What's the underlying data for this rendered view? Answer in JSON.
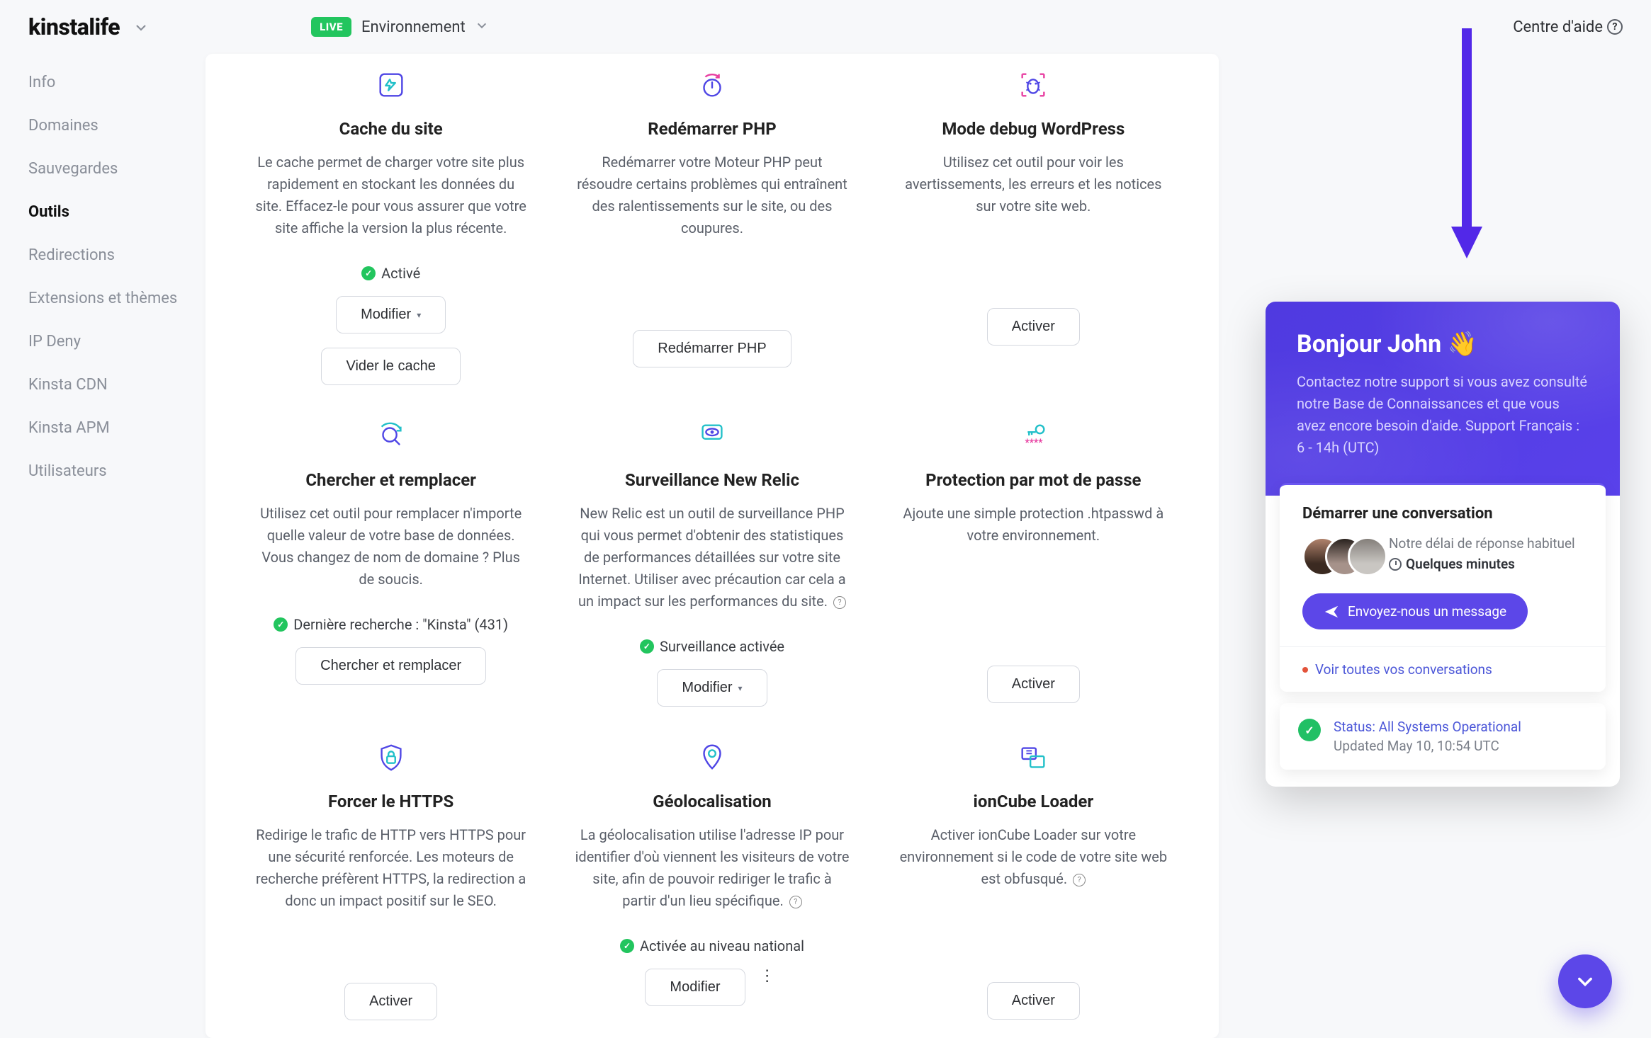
{
  "brand": "kinstalife",
  "header": {
    "live_badge": "LIVE",
    "env_label": "Environnement",
    "help": "Centre d'aide"
  },
  "sidebar": {
    "items": [
      {
        "label": "Info",
        "active": false
      },
      {
        "label": "Domaines",
        "active": false
      },
      {
        "label": "Sauvegardes",
        "active": false
      },
      {
        "label": "Outils",
        "active": true
      },
      {
        "label": "Redirections",
        "active": false
      },
      {
        "label": "Extensions et thèmes",
        "active": false
      },
      {
        "label": "IP Deny",
        "active": false
      },
      {
        "label": "Kinsta CDN",
        "active": false
      },
      {
        "label": "Kinsta APM",
        "active": false
      },
      {
        "label": "Utilisateurs",
        "active": false
      }
    ]
  },
  "tools": [
    {
      "id": "cache",
      "icon": "bolt-refresh",
      "title": "Cache du site",
      "desc": "Le cache permet de charger votre site plus rapidement en stockant les données du site. Effacez-le pour vous assurer que votre site affiche la version la plus récente.",
      "status": "Activé",
      "buttons": [
        {
          "label": "Modifier",
          "caret": true
        },
        {
          "label": "Vider le cache"
        }
      ]
    },
    {
      "id": "restart-php",
      "icon": "power-refresh",
      "title": "Redémarrer PHP",
      "desc": "Redémarrer votre Moteur PHP peut résoudre certains problèmes qui entraînent des ralentissements sur le site, ou des coupures.",
      "buttons": [
        {
          "label": "Redémarrer PHP"
        }
      ]
    },
    {
      "id": "wp-debug",
      "icon": "bug-scan",
      "title": "Mode debug WordPress",
      "desc": "Utilisez cet outil pour voir les avertissements, les erreurs et les notices sur votre site web.",
      "buttons": [
        {
          "label": "Activer"
        }
      ]
    },
    {
      "id": "search-replace",
      "icon": "search-loop",
      "title": "Chercher et remplacer",
      "desc": "Utilisez cet outil pour remplacer n'importe quelle valeur de votre base de données. Vous changez de nom de domaine ? Plus de soucis.",
      "status": "Dernière recherche : \"Kinsta\" (431)",
      "buttons": [
        {
          "label": "Chercher et remplacer"
        }
      ]
    },
    {
      "id": "newrelic",
      "icon": "eye-monitor",
      "title": "Surveillance New Relic",
      "desc": "New Relic est un outil de surveillance PHP qui vous permet d'obtenir des statistiques de performances détaillées sur votre site Internet. Utiliser avec précaution car cela a un impact sur les performances du site.",
      "info": true,
      "status": "Surveillance activée",
      "buttons": [
        {
          "label": "Modifier",
          "caret": true
        }
      ]
    },
    {
      "id": "password",
      "icon": "key-mask",
      "title": "Protection par mot de passe",
      "desc": "Ajoute une simple protection .htpasswd à votre environnement.",
      "buttons": [
        {
          "label": "Activer"
        }
      ]
    },
    {
      "id": "force-https",
      "icon": "shield-lock",
      "title": "Forcer le HTTPS",
      "desc": "Redirige le trafic de HTTP vers HTTPS pour une sécurité renforcée. Les moteurs de recherche préfèrent HTTPS, la redirection a donc un impact positif sur le SEO.",
      "buttons": [
        {
          "label": "Activer"
        }
      ]
    },
    {
      "id": "geo",
      "icon": "pin",
      "title": "Géolocalisation",
      "desc": "La géolocalisation utilise l'adresse IP pour identifier d'où viennent les visiteurs de votre site, afin de pouvoir rediriger le trafic à partir d'un lieu spécifique.",
      "info": true,
      "status": "Activée au niveau national",
      "buttons": [
        {
          "label": "Modifier",
          "dots": true
        }
      ]
    },
    {
      "id": "ioncube",
      "icon": "cube-stack",
      "title": "ionCube Loader",
      "desc": "Activer ionCube Loader sur votre environnement si le code de votre site web est obfusqué.",
      "info": true,
      "buttons": [
        {
          "label": "Activer"
        }
      ]
    }
  ],
  "chat": {
    "greeting": "Bonjour John 👋",
    "sub": "Contactez notre support si vous avez consulté notre Base de Connaissances et que vous avez encore besoin d'aide. Support Français : 6 - 14h (UTC)",
    "card_title": "Démarrer une conversation",
    "response_line": "Notre délai de réponse habituel",
    "response_time": "Quelques minutes",
    "send_label": "Envoyez-nous un message",
    "all_convs": "Voir toutes vos conversations",
    "status_line": "Status: All Systems Operational",
    "status_updated": "Updated May 10, 10:54 UTC"
  }
}
